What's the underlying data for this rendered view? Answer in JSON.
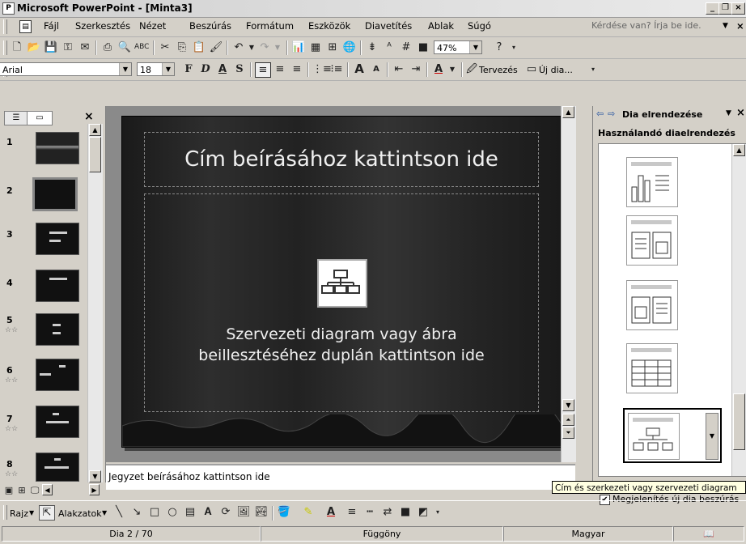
{
  "window": {
    "title": "Microsoft PowerPoint - [Minta3]"
  },
  "menu": {
    "items": [
      "Fájl",
      "Szerkesztés",
      "Nézet",
      "Beszúrás",
      "Formátum",
      "Eszközök",
      "Diavetítés",
      "Ablak",
      "Súgó"
    ],
    "help_placeholder": "Kérdése van? Írja be ide."
  },
  "standard_toolbar": {
    "zoom": "47%"
  },
  "format_toolbar": {
    "font": "Arial",
    "size": "18",
    "bold": "F",
    "italic": "D",
    "underline": "A",
    "shadow": "S",
    "design": "Tervezés",
    "new_slide": "Új dia..."
  },
  "slides_pane": {
    "numbers": [
      "1",
      "2",
      "3",
      "4",
      "5",
      "6",
      "7",
      "8"
    ],
    "selected": "2"
  },
  "slide": {
    "title_placeholder": "Cím beírásához kattintson ide",
    "body_line1": "Szervezeti diagram vagy ábra",
    "body_line2": "beillesztéséhez duplán kattintson ide"
  },
  "notes": {
    "placeholder": "Jegyzet beírásához kattintson ide"
  },
  "task_pane": {
    "title": "Dia elrendezése",
    "section": "Használandó diaelrendezés",
    "checkbox_label": "Megjelenítés új dia beszúrás",
    "tooltip": "Cím és szerkezeti vagy szervezeti diagram"
  },
  "draw_toolbar": {
    "draw": "Rajz",
    "autoshapes": "Alakzatok"
  },
  "status": {
    "slide": "Dia 2 / 70",
    "design": "Függöny",
    "language": "Magyar"
  },
  "colors": {
    "slide_bg": "#222222",
    "title_bar": "#d8d8d8",
    "tooltip_bg": "#ffffe1"
  }
}
